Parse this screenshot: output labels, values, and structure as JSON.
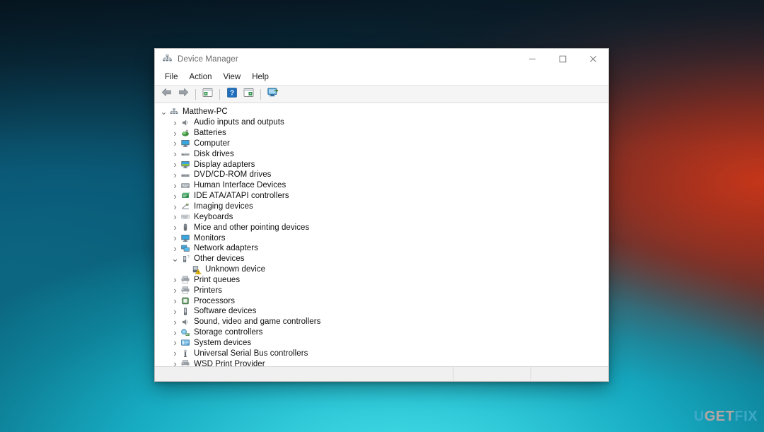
{
  "window": {
    "title": "Device Manager",
    "title_icon": "device-manager-icon",
    "controls": {
      "minimize": "–",
      "maximize": "☐",
      "close": "✕"
    }
  },
  "menubar": {
    "items": [
      {
        "label": "File"
      },
      {
        "label": "Action"
      },
      {
        "label": "View"
      },
      {
        "label": "Help"
      }
    ]
  },
  "toolbar": {
    "buttons": [
      {
        "name": "back-button",
        "icon": "left-arrow-icon",
        "tooltip": "Back"
      },
      {
        "name": "forward-button",
        "icon": "right-arrow-icon",
        "tooltip": "Forward"
      },
      {
        "name": "properties-button",
        "icon": "properties-icon",
        "tooltip": "Properties"
      },
      {
        "name": "help-button",
        "icon": "help-question-icon",
        "tooltip": "Help"
      },
      {
        "name": "update-driver-button",
        "icon": "update-driver-icon",
        "tooltip": "Update driver"
      },
      {
        "name": "scan-hardware-button",
        "icon": "scan-hardware-icon",
        "tooltip": "Scan for hardware changes"
      }
    ]
  },
  "tree": {
    "root": {
      "label": "Matthew-PC",
      "icon": "computer-root-icon",
      "expanded": true,
      "twisty": "⌄"
    },
    "items": [
      {
        "label": "Audio inputs and outputs",
        "icon": "speaker-icon",
        "depth": 1,
        "expanded": false
      },
      {
        "label": "Batteries",
        "icon": "battery-icon",
        "depth": 1,
        "expanded": false
      },
      {
        "label": "Computer",
        "icon": "monitor-icon",
        "depth": 1,
        "expanded": false
      },
      {
        "label": "Disk drives",
        "icon": "disk-drive-icon",
        "depth": 1,
        "expanded": false
      },
      {
        "label": "Display adapters",
        "icon": "display-adapter-icon",
        "depth": 1,
        "expanded": false
      },
      {
        "label": "DVD/CD-ROM drives",
        "icon": "optical-drive-icon",
        "depth": 1,
        "expanded": false
      },
      {
        "label": "Human Interface Devices",
        "icon": "hid-icon",
        "depth": 1,
        "expanded": false
      },
      {
        "label": "IDE ATA/ATAPI controllers",
        "icon": "ide-controller-icon",
        "depth": 1,
        "expanded": false
      },
      {
        "label": "Imaging devices",
        "icon": "imaging-device-icon",
        "depth": 1,
        "expanded": false
      },
      {
        "label": "Keyboards",
        "icon": "keyboard-icon",
        "depth": 1,
        "expanded": false
      },
      {
        "label": "Mice and other pointing devices",
        "icon": "mouse-icon",
        "depth": 1,
        "expanded": false
      },
      {
        "label": "Monitors",
        "icon": "monitor-icon",
        "depth": 1,
        "expanded": false
      },
      {
        "label": "Network adapters",
        "icon": "network-adapter-icon",
        "depth": 1,
        "expanded": false
      },
      {
        "label": "Other devices",
        "icon": "other-devices-icon",
        "depth": 1,
        "expanded": true
      },
      {
        "label": "Unknown device",
        "icon": "unknown-device-warning-icon",
        "depth": 2,
        "expanded": null
      },
      {
        "label": "Print queues",
        "icon": "printer-icon",
        "depth": 1,
        "expanded": false
      },
      {
        "label": "Printers",
        "icon": "printer-icon",
        "depth": 1,
        "expanded": false
      },
      {
        "label": "Processors",
        "icon": "processor-icon",
        "depth": 1,
        "expanded": false
      },
      {
        "label": "Software devices",
        "icon": "software-device-icon",
        "depth": 1,
        "expanded": false
      },
      {
        "label": "Sound, video and game controllers",
        "icon": "speaker-icon",
        "depth": 1,
        "expanded": false
      },
      {
        "label": "Storage controllers",
        "icon": "storage-controller-icon",
        "depth": 1,
        "expanded": false
      },
      {
        "label": "System devices",
        "icon": "system-device-icon",
        "depth": 1,
        "expanded": false
      },
      {
        "label": "Universal Serial Bus controllers",
        "icon": "usb-controller-icon",
        "depth": 1,
        "expanded": false
      },
      {
        "label": "WSD Print Provider",
        "icon": "printer-icon",
        "depth": 1,
        "expanded": false
      }
    ],
    "collapsed_glyph": "›",
    "expanded_glyph": "⌄"
  },
  "statusbar": {
    "main": "",
    "pane1": "",
    "pane2": ""
  },
  "watermark": {
    "part1": "U",
    "part2": "GET",
    "part3": "FIX"
  },
  "colors": {
    "titlebar_bg": "#ffffff",
    "window_bg": "#f0f0f0",
    "content_bg": "#ffffff",
    "accent_cyan": "#2ec8d8",
    "accent_red": "#cd3719",
    "warning_yellow": "#f5c518",
    "text": "#111111",
    "title_text": "#6a6a6a"
  }
}
